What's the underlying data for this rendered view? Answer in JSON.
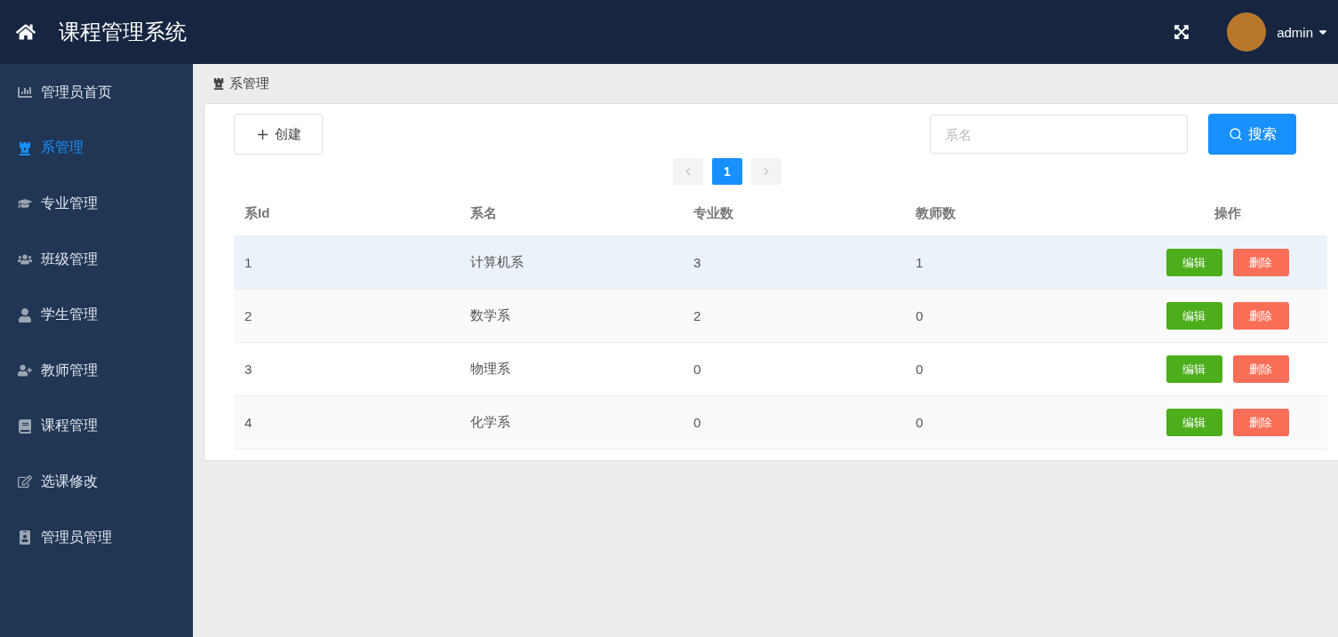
{
  "header": {
    "title": "课程管理系统",
    "user": "admin"
  },
  "sidebar": {
    "items": [
      {
        "label": "管理员首页",
        "selected": false
      },
      {
        "label": "系管理",
        "selected": true
      },
      {
        "label": "专业管理",
        "selected": false
      },
      {
        "label": "班级管理",
        "selected": false
      },
      {
        "label": "学生管理",
        "selected": false
      },
      {
        "label": "教师管理",
        "selected": false
      },
      {
        "label": "课程管理",
        "selected": false
      },
      {
        "label": "选课修改",
        "selected": false
      },
      {
        "label": "管理员管理",
        "selected": false
      }
    ]
  },
  "breadcrumb": "系管理",
  "toolbar": {
    "create": "创建",
    "search_placeholder": "系名",
    "search": "搜索"
  },
  "pagination": {
    "prev_disabled": true,
    "next_disabled": true,
    "pages": [
      {
        "label": "1",
        "selected": true
      }
    ]
  },
  "table": {
    "columns": [
      "系Id",
      "系名",
      "专业数",
      "教师数",
      "操作"
    ],
    "rows": [
      {
        "cells": [
          "1",
          "计算机系",
          "3",
          "1"
        ],
        "hovered": true,
        "actions": [
          "编辑",
          "删除"
        ]
      },
      {
        "cells": [
          "2",
          "数学系",
          "2",
          "0"
        ],
        "hovered": false,
        "actions": [
          "编辑",
          "删除"
        ]
      },
      {
        "cells": [
          "3",
          "物理系",
          "0",
          "0"
        ],
        "hovered": false,
        "actions": [
          "编辑",
          "删除"
        ]
      },
      {
        "cells": [
          "4",
          "化学系",
          "0",
          "0"
        ],
        "hovered": false,
        "actions": [
          "编辑",
          "删除"
        ]
      }
    ]
  }
}
